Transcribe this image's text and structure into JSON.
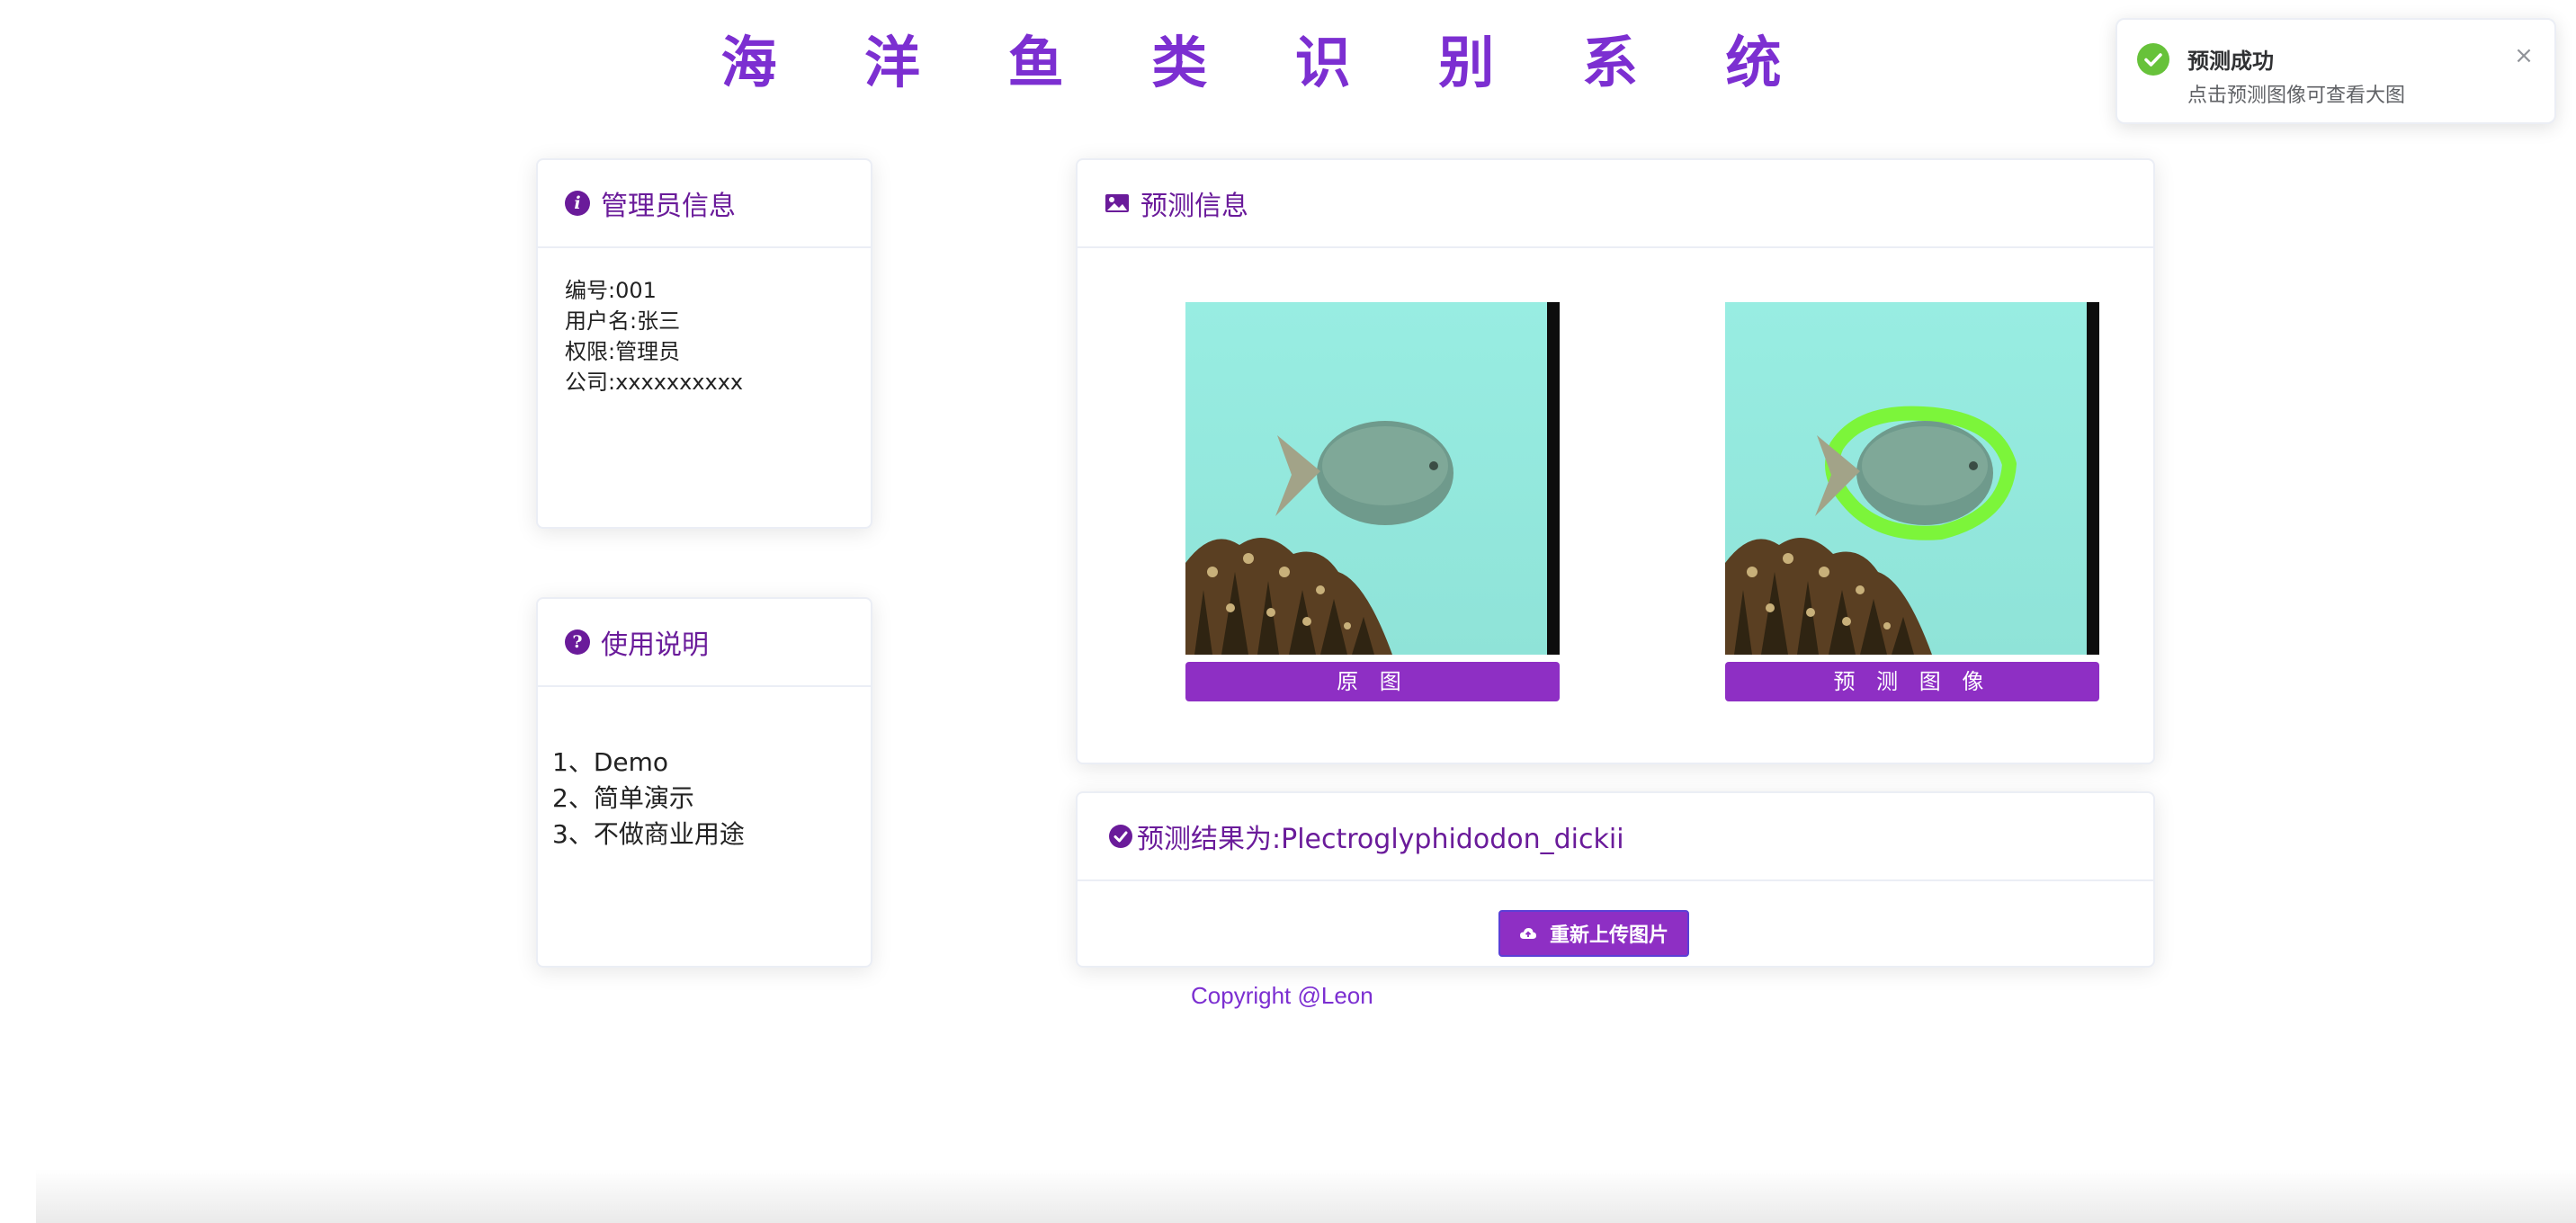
{
  "page": {
    "title": "海 洋 鱼 类 识 别 系 统",
    "copyright": "Copyright @Leon"
  },
  "admin_card": {
    "title": "管理员信息",
    "icon": "info-icon",
    "lines": [
      "编号:001",
      "用户名:张三",
      "权限:管理员",
      "公司:xxxxxxxxxx"
    ]
  },
  "usage_card": {
    "title": "使用说明",
    "icon": "question-icon",
    "lines": [
      "1、Demo",
      "2、简单演示",
      "3、不做商业用途"
    ]
  },
  "predict_card": {
    "title": "预测信息",
    "icon": "image-icon",
    "original_button": "原 图",
    "predicted_button": "预 测 图 像"
  },
  "result_card": {
    "icon": "check-circle-icon",
    "title": "预测结果为:Plectroglyphidodon_dickii",
    "upload_button": "重新上传图片",
    "upload_icon": "cloud-upload-icon"
  },
  "toast": {
    "title": "预测成功",
    "message": "点击预测图像可查看大图",
    "icon": "success-icon",
    "close_icon": "close-icon"
  },
  "colors": {
    "accent": "#7c2fd1",
    "header_text": "#6a1b9a",
    "button_bg": "#8e2fc4",
    "success": "#67c23a",
    "outline_green": "#7cf53a"
  }
}
